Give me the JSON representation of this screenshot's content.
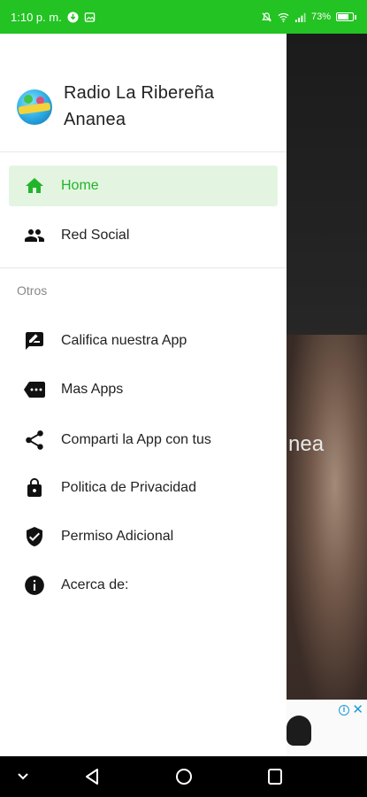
{
  "status_bar": {
    "time": "1:10 p. m.",
    "battery": "73%",
    "battery_level": 0.73,
    "background_color": "#22c322"
  },
  "drawer": {
    "app_name": "Radio La Ribereña Ananea",
    "accent_color": "#22b52a",
    "primary_items": [
      {
        "label": "Home",
        "icon": "home-icon",
        "active": true
      },
      {
        "label": "Red Social",
        "icon": "people-icon",
        "active": false
      }
    ],
    "section_title": "Otros",
    "other_items": [
      {
        "label": "Califica nuestra App",
        "icon": "rate-review-icon"
      },
      {
        "label": "Mas Apps",
        "icon": "more-apps-icon"
      },
      {
        "label": "Comparti la App con tus",
        "icon": "share-icon"
      },
      {
        "label": "Politica de Privacidad",
        "icon": "lock-icon"
      },
      {
        "label": "Permiso Adicional",
        "icon": "shield-check-icon"
      },
      {
        "label": "Acerca de:",
        "icon": "info-icon"
      }
    ]
  },
  "background": {
    "title_fragment": "nea"
  },
  "navigation_bar": {
    "buttons": [
      "chevron-down-icon",
      "back-icon",
      "home-circle-icon",
      "recents-icon"
    ]
  }
}
